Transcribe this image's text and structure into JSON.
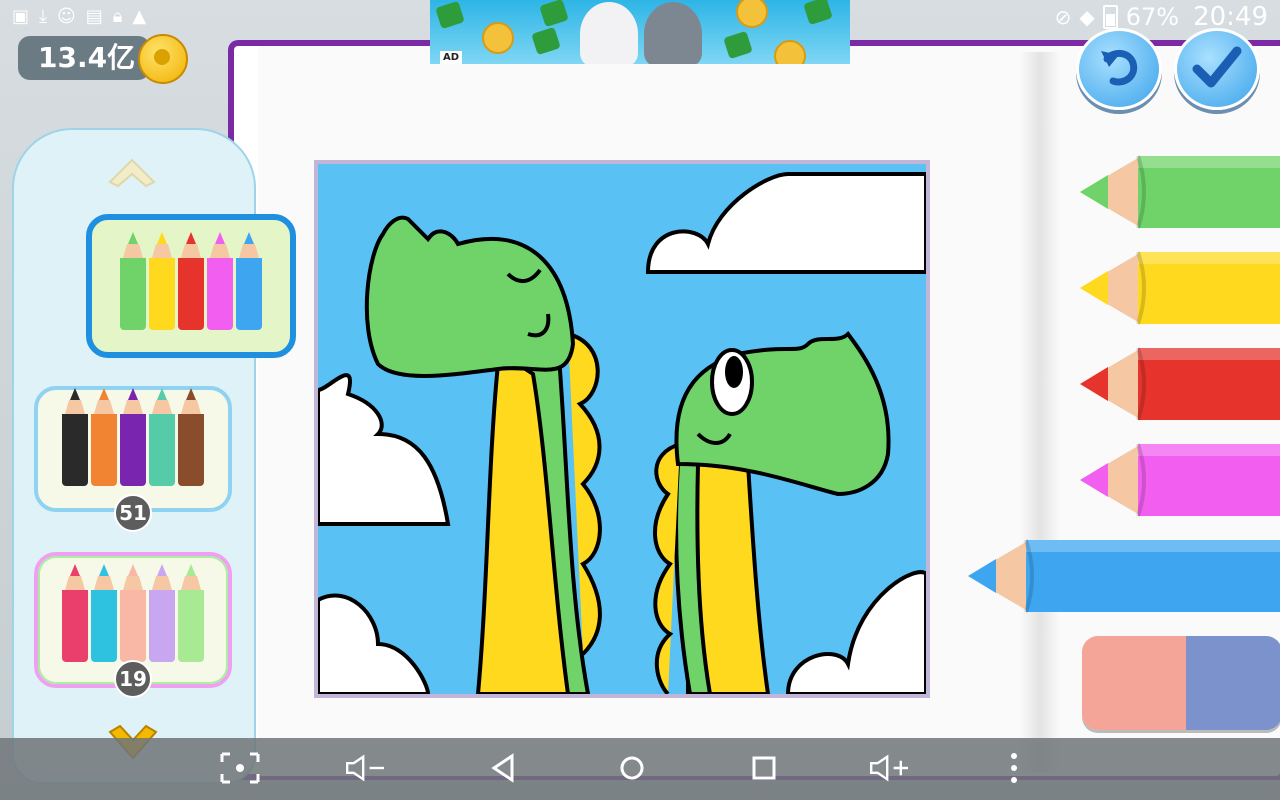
{
  "status_bar": {
    "battery_percent": "67%",
    "time": "20:49",
    "left_icons": [
      "image-icon",
      "download-icon",
      "app-icon",
      "app-icon",
      "lock-icon",
      "warning-icon"
    ],
    "right_icons": [
      "no-disturb-icon",
      "wifi-icon",
      "battery-icon"
    ]
  },
  "ad": {
    "tag": "AD"
  },
  "coins": {
    "amount": "13.4亿"
  },
  "palette": {
    "sets": [
      {
        "name": "basic",
        "selected": true,
        "colors": [
          "#6fd36a",
          "#ffd91e",
          "#e6332c",
          "#f25ef0",
          "#3ea6f0"
        ]
      },
      {
        "name": "dark",
        "badge": "51",
        "colors": [
          "#2a2a2a",
          "#f08432",
          "#7a25b0",
          "#56cba8",
          "#8a4d2c"
        ]
      },
      {
        "name": "patterns",
        "badge": "19",
        "colors": [
          "#ea3e6c",
          "#2ec2e0",
          "#f9b8a6",
          "#c9a6f0",
          "#a8ea94"
        ]
      }
    ]
  },
  "pencils": [
    {
      "color": "#6fd36a",
      "name": "green",
      "selected": false
    },
    {
      "color": "#ffd91e",
      "name": "yellow",
      "selected": false
    },
    {
      "color": "#e6332c",
      "name": "red",
      "selected": false
    },
    {
      "color": "#f25ef0",
      "name": "pink",
      "selected": false
    },
    {
      "color": "#3ea6f0",
      "name": "blue",
      "selected": true
    }
  ],
  "buttons": {
    "undo_icon": "undo-icon",
    "done_icon": "check-icon"
  },
  "navbar": [
    "screenshot-icon",
    "volume-down-icon",
    "back-icon",
    "home-icon",
    "recents-icon",
    "volume-up-icon",
    "more-icon"
  ]
}
